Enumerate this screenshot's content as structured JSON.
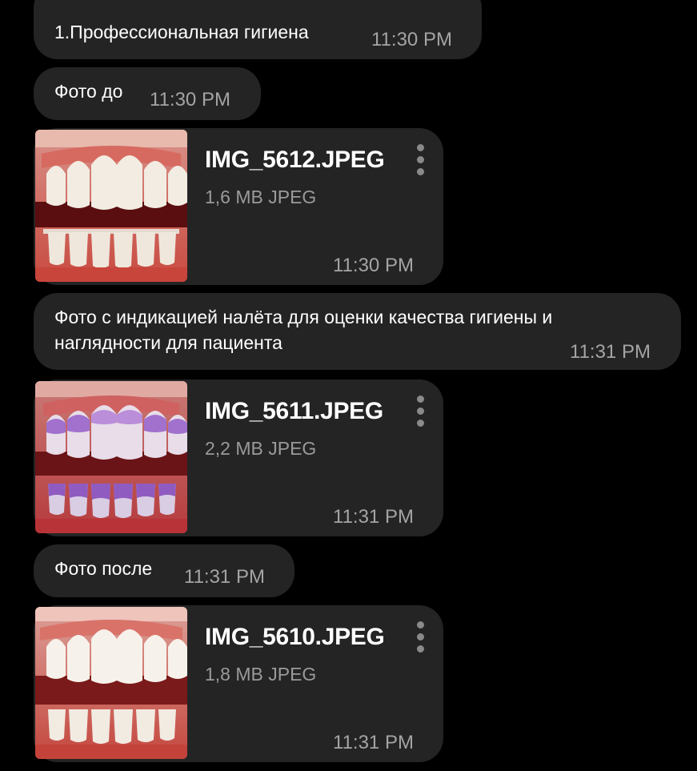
{
  "messages": [
    {
      "type": "text",
      "text": "1.Профессиональная гигиена",
      "time": "11:30 PM"
    },
    {
      "type": "text",
      "text": "Фото до",
      "time": "11:30 PM"
    },
    {
      "type": "file",
      "name": "IMG_5612.JPEG",
      "meta": "1,6 MB JPEG",
      "time": "11:30 PM"
    },
    {
      "type": "text",
      "lines": [
        "Фото с индикацией налёта для оценки качества гигиены и",
        "наглядности для пациента"
      ],
      "time": "11:31 PM"
    },
    {
      "type": "file",
      "name": "IMG_5611.JPEG",
      "meta": "2,2 MB JPEG",
      "time": "11:31 PM"
    },
    {
      "type": "text",
      "text": "Фото после",
      "time": "11:31 PM"
    },
    {
      "type": "file",
      "name": "IMG_5610.JPEG",
      "meta": "1,8 MB JPEG",
      "time": "11:31 PM"
    }
  ],
  "colors": {
    "background": "#000000",
    "bubble": "#242424",
    "time": "#a4a4a4",
    "meta": "#9a9a9a"
  },
  "icons": {
    "menu": "more-vertical-icon"
  }
}
